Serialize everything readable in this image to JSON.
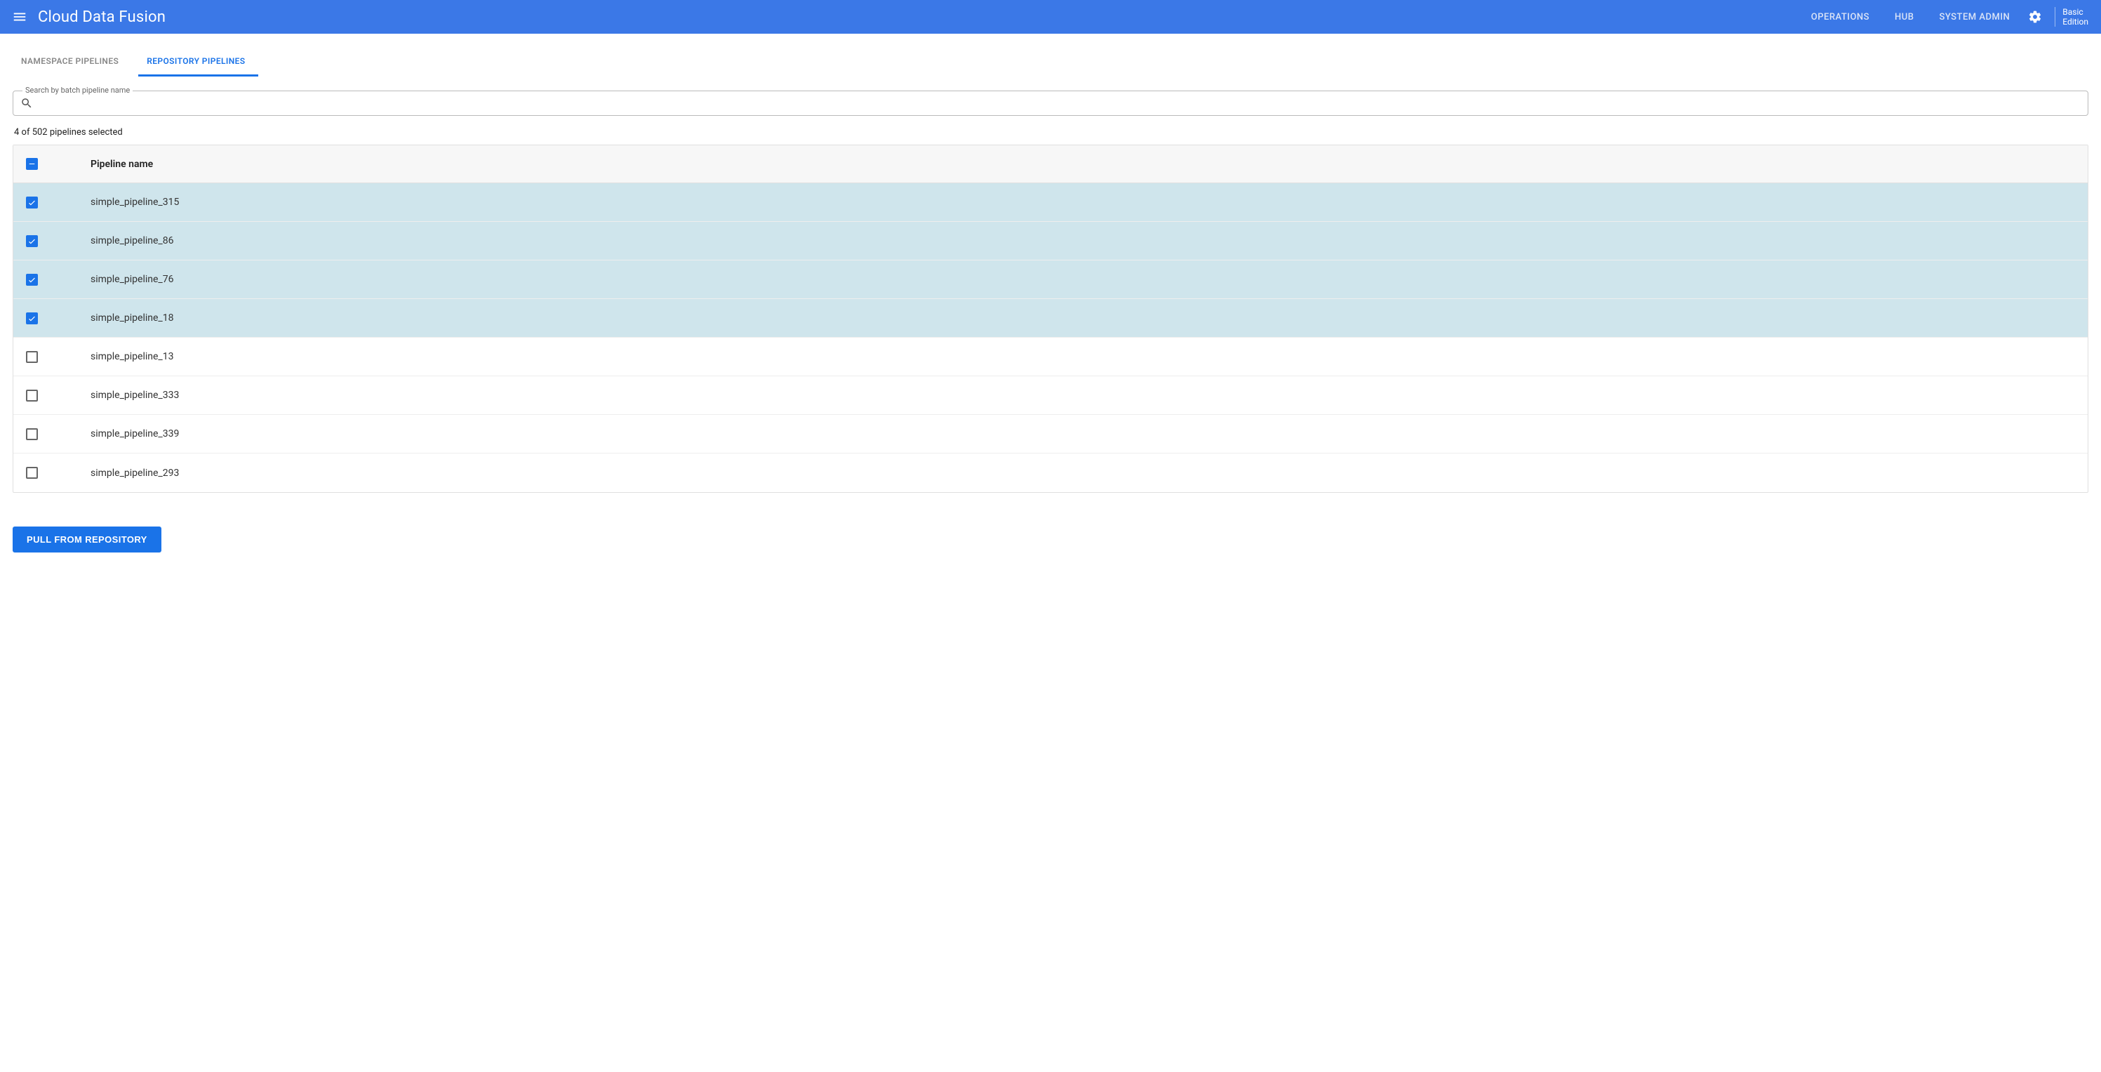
{
  "header": {
    "app_title": "Cloud Data Fusion",
    "nav": {
      "operations": "OPERATIONS",
      "hub": "HUB",
      "system_admin": "SYSTEM ADMIN"
    },
    "edition_line1": "Basic",
    "edition_line2": "Edition"
  },
  "tabs": {
    "namespace": "NAMESPACE PIPELINES",
    "repository": "REPOSITORY PIPELINES"
  },
  "search": {
    "label": "Search by batch pipeline name",
    "value": ""
  },
  "selection_text": "4 of 502 pipelines selected",
  "table": {
    "col_pipeline_name": "Pipeline name",
    "rows": [
      {
        "name": "simple_pipeline_315",
        "selected": true
      },
      {
        "name": "simple_pipeline_86",
        "selected": true
      },
      {
        "name": "simple_pipeline_76",
        "selected": true
      },
      {
        "name": "simple_pipeline_18",
        "selected": true
      },
      {
        "name": "simple_pipeline_13",
        "selected": false
      },
      {
        "name": "simple_pipeline_333",
        "selected": false
      },
      {
        "name": "simple_pipeline_339",
        "selected": false
      },
      {
        "name": "simple_pipeline_293",
        "selected": false
      }
    ]
  },
  "actions": {
    "pull_button": "PULL FROM REPOSITORY"
  }
}
